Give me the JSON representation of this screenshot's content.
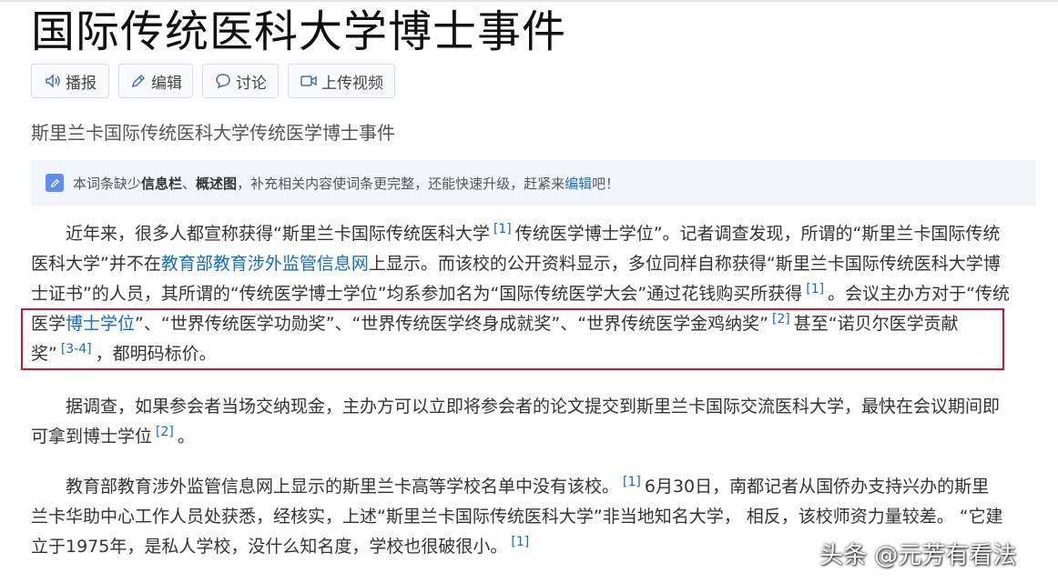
{
  "title": "国际传统医科大学博士事件",
  "toolbar": {
    "broadcast": "播报",
    "edit": "编辑",
    "discuss": "讨论",
    "upload_video": "上传视频"
  },
  "subtitle": "斯里兰卡国际传统医科大学传统医学博士事件",
  "notice": {
    "t1": "本词条缺少",
    "b1": "信息栏",
    "sep": "、",
    "b2": "概述图",
    "t2": "，补充相关内容使词条更完整，还能快速升级，赶紧来",
    "link": "编辑",
    "t3": "吧！"
  },
  "p1": {
    "l1a": "近年来，很多人都宣称获得“斯里兰卡国际传统医科大学",
    "ref1": "[1]",
    "l1b": "传统医学博士学位”。记者调查发现，所谓的“斯里兰卡国际传统",
    "l2a": "医科大学”并不在",
    "l2link": "教育部教育涉外监管信息网",
    "l2b": "上显示。而该校的公开资料显示，多位同样自称获得“斯里兰卡国际传统医科大学博",
    "l3a": "士证书”的人员，其所谓的“传统医学博士学位”均系参加名为“国际传统医学大会”通过花钱购买所获得",
    "ref2": "[1]",
    "l3b": "。会议主办方对于“传统",
    "l4a": "医学",
    "l4link": "博士学位",
    "l4b": "”、“世界传统医学功勋奖”、“世界传统医学终身成就奖”、“世界传统医学金鸡纳奖”",
    "ref3": "[2]",
    "l4c": "甚至“诺贝尔医学贡献",
    "l5a": "奖”",
    "ref4": "[3-4]",
    "l5b": "，都明码标价。"
  },
  "p2": {
    "l1": "据调查，如果参会者当场交纳现金，主办方可以立即将参会者的论文提交到斯里兰卡国际交流医科大学，最快在会议期间即",
    "l2a": "可拿到博士学位",
    "ref": "[2]",
    "l2b": "。"
  },
  "p3": {
    "l1a": "教育部教育涉外监管信息网上显示的斯里兰卡高等学校名单中没有该校。",
    "ref1": "[1]",
    "l1b": "6月30日，南都记者从国侨办支持兴办的斯里",
    "l2": "兰卡华助中心工作人员处获悉，经核实，上述“斯里兰卡国际传统医科大学”非当地知名大学，  相反，该校师资力量较差。 “它建",
    "l3a": "立于1975年，是私人学校，没什么知名度，学校也很破很小。",
    "ref2": "[1]"
  },
  "watermark": "头条 @元芳有看法",
  "colors": {
    "link": "#136ec2",
    "highlight_box": "#d9122e",
    "notice_bg": "#f2f5fb"
  },
  "icons": [
    "speaker-icon",
    "pencil-icon",
    "chat-bubble-icon",
    "video-camera-icon",
    "edit-note-icon"
  ]
}
